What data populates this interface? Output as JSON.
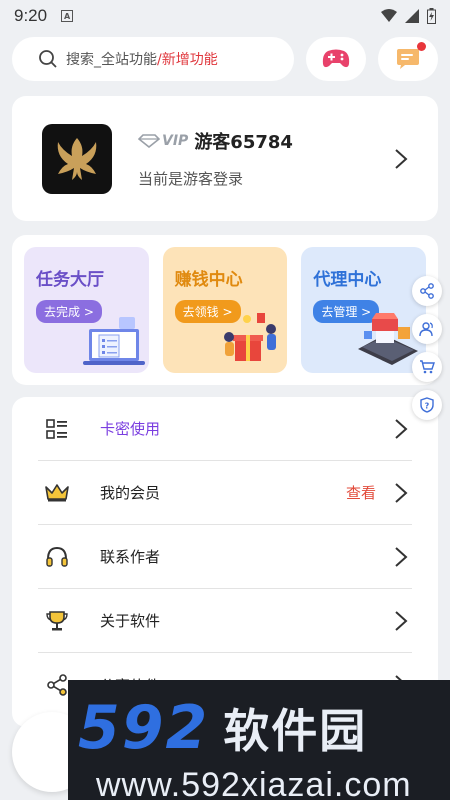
{
  "status_bar": {
    "time": "9:20",
    "notification_icon": "A"
  },
  "search": {
    "placeholder_main": "搜索_全站功能",
    "placeholder_extra": "/新增功能"
  },
  "profile": {
    "vip_label": "VIP",
    "username": "游客65784",
    "subtitle": "当前是游客登录"
  },
  "tiles": [
    {
      "title": "任务大厅",
      "button": "去完成 >"
    },
    {
      "title": "赚钱中心",
      "button": "去领钱 >"
    },
    {
      "title": "代理中心",
      "button": "去管理 >"
    }
  ],
  "menu": [
    {
      "label": "卡密使用",
      "icon": "card-key-icon"
    },
    {
      "label": "我的会员",
      "icon": "crown-icon",
      "extra": "查看"
    },
    {
      "label": "联系作者",
      "icon": "headset-icon"
    },
    {
      "label": "关于软件",
      "icon": "trophy-icon"
    },
    {
      "label": "分享软件",
      "icon": "share-icon"
    }
  ],
  "colors": {
    "accent_purple": "#7a3de0",
    "accent_red": "#e24a3a",
    "background": "#eef0f3"
  },
  "watermark": {
    "digits": "592",
    "name": "软件园",
    "url": "www.592xiazai.com"
  }
}
